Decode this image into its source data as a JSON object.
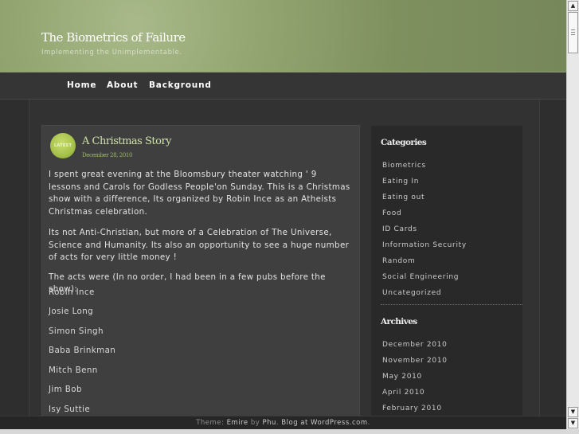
{
  "site": {
    "title": "The Biometrics of Failure",
    "description": "Implementing the Unimplementable."
  },
  "nav": {
    "items": [
      {
        "label": "Home"
      },
      {
        "label": "About"
      },
      {
        "label": "Background"
      }
    ]
  },
  "post": {
    "badge": "LATEST",
    "title": "A Christmas Story",
    "date": "December 28, 2010",
    "paragraphs": [
      "I spent great evening at the Bloomsbury theater watching ' 9 lessons and Carols for Godless People'on Sunday. This is a Christmas show with a difference, Its organized by Robin Ince as an Atheists Christmas celebration.",
      "Its not Anti-Christian, but more of  a Celebration of The Universe, Science and Humanity. Its also an opportunity to see a huge number of acts for very little money !",
      "The acts were (In no order, I had been in a few pubs before the show):"
    ],
    "acts": [
      "Robin Ince",
      "Josie Long",
      "Simon Singh",
      "Baba Brinkman",
      "Mitch Benn",
      "Jim Bob",
      "Isy Suttie"
    ]
  },
  "sidebar": {
    "categories_title": "Categories",
    "categories": [
      "Biometrics",
      "Eating In",
      "Eating out",
      "Food",
      "ID Cards",
      "Information Security",
      "Random",
      "Social Engineering",
      "Uncategorized"
    ],
    "archives_title": "Archives",
    "archives": [
      "December 2010",
      "November 2010",
      "May 2010",
      "April 2010",
      "February 2010"
    ]
  },
  "footer": {
    "prefix": "Theme: ",
    "theme": "Emire",
    "by": " by ",
    "author": "Phu",
    "suffix": ". ",
    "blog_link": "Blog at WordPress.com",
    "end": "."
  },
  "scrollbar": {
    "up_glyph": "▲",
    "down_glyph": "▼"
  }
}
